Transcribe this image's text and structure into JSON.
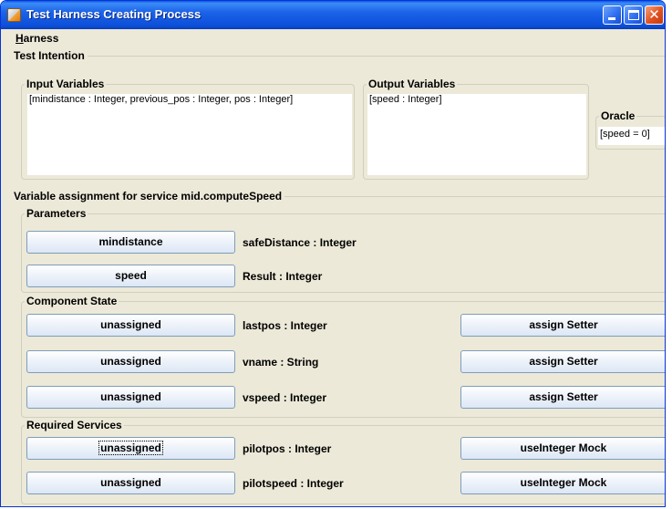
{
  "window": {
    "title": "Test Harness Creating Process"
  },
  "menu": {
    "harness": "Harness"
  },
  "test_intention": {
    "legend": "Test Intention",
    "input_variables": {
      "legend": "Input Variables",
      "text": "[mindistance : Integer, previous_pos : Integer, pos : Integer]"
    },
    "output_variables": {
      "legend": "Output Variables",
      "text": "[speed : Integer]"
    },
    "oracle": {
      "legend": "Oracle",
      "text": "[speed = 0]"
    }
  },
  "assignment": {
    "legend": "Variable assignment for service mid.computeSpeed",
    "parameters": {
      "legend": "Parameters",
      "rows": [
        {
          "button": "mindistance",
          "label": "safeDistance : Integer"
        },
        {
          "button": "speed",
          "label": "Result : Integer"
        }
      ]
    },
    "component_state": {
      "legend": "Component State",
      "rows": [
        {
          "button": "unassigned",
          "label": "lastpos : Integer",
          "action": "assign Setter"
        },
        {
          "button": "unassigned",
          "label": "vname : String",
          "action": "assign Setter"
        },
        {
          "button": "unassigned",
          "label": "vspeed : Integer",
          "action": "assign Setter"
        }
      ]
    },
    "required_services": {
      "legend": "Required Services",
      "rows": [
        {
          "button": "unassigned",
          "label": "pilotpos : Integer",
          "action": "useInteger Mock"
        },
        {
          "button": "unassigned",
          "label": "pilotspeed : Integer",
          "action": "useInteger Mock"
        }
      ]
    }
  }
}
